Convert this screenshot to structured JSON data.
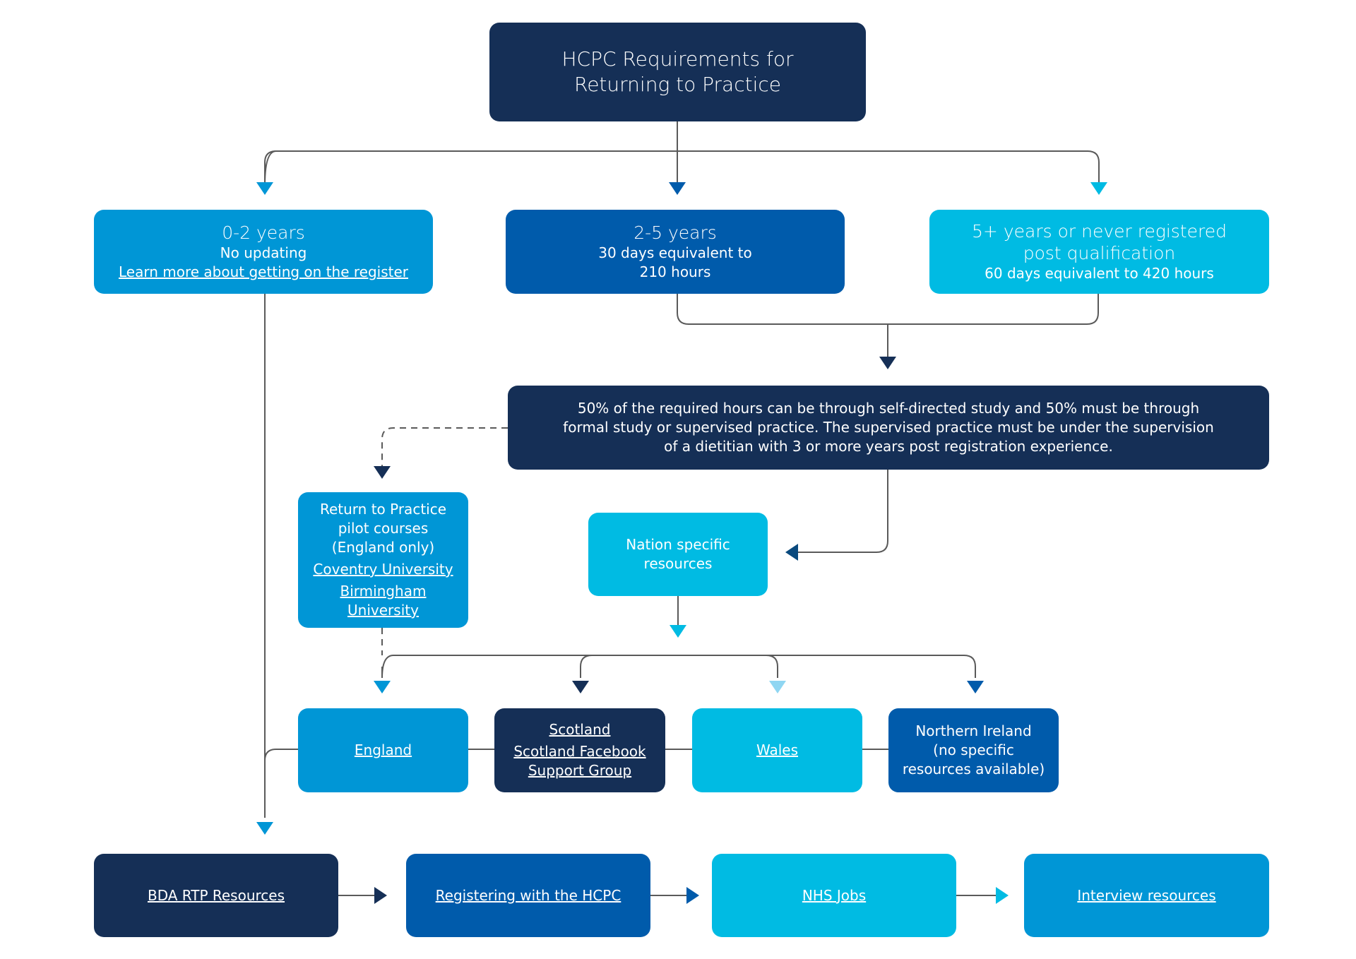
{
  "colors": {
    "navy": "#152f56",
    "blue": "#005bab",
    "mid_blue": "#0096d6",
    "cyan": "#00bbe3",
    "light_cyan": "#8fd6f2",
    "connector": "#555555"
  },
  "title": {
    "line1": "HCPC Requirements for",
    "line2": "Returning to Practice"
  },
  "categories": [
    {
      "heading": "0-2 years",
      "detail": "No updating",
      "link": "Learn more about getting on the register"
    },
    {
      "heading": "2-5 years",
      "detail_line1": "30 days equivalent to",
      "detail_line2": "210 hours"
    },
    {
      "heading_line1": "5+ years or never registered",
      "heading_line2": "post qualification",
      "detail": "60 days equivalent to 420 hours"
    }
  ],
  "requirement_note": {
    "line1": "50% of the required hours can be through self-directed study and 50% must be through",
    "line2": "formal study or supervised practice. The supervised practice must be under the supervision",
    "line3": "of a dietitian with 3 or more years post registration experience."
  },
  "pilot_courses": {
    "line1": "Return to Practice",
    "line2": "pilot courses",
    "line3": "(England only)",
    "links": [
      "Coventry University",
      "Birmingham University"
    ]
  },
  "nation_specific": {
    "line1": "Nation specific",
    "line2": "resources"
  },
  "nations": {
    "england": "England",
    "scotland": "Scotland",
    "scotland_fb_line1": "Scotland Facebook",
    "scotland_fb_line2": "Support Group",
    "wales": "Wales",
    "ni_line1": "Northern Ireland",
    "ni_line2": "(no specific",
    "ni_line3": "resources available)"
  },
  "final_steps": [
    "BDA RTP Resources",
    "Registering with the HCPC",
    "NHS Jobs",
    "Interview resources"
  ]
}
